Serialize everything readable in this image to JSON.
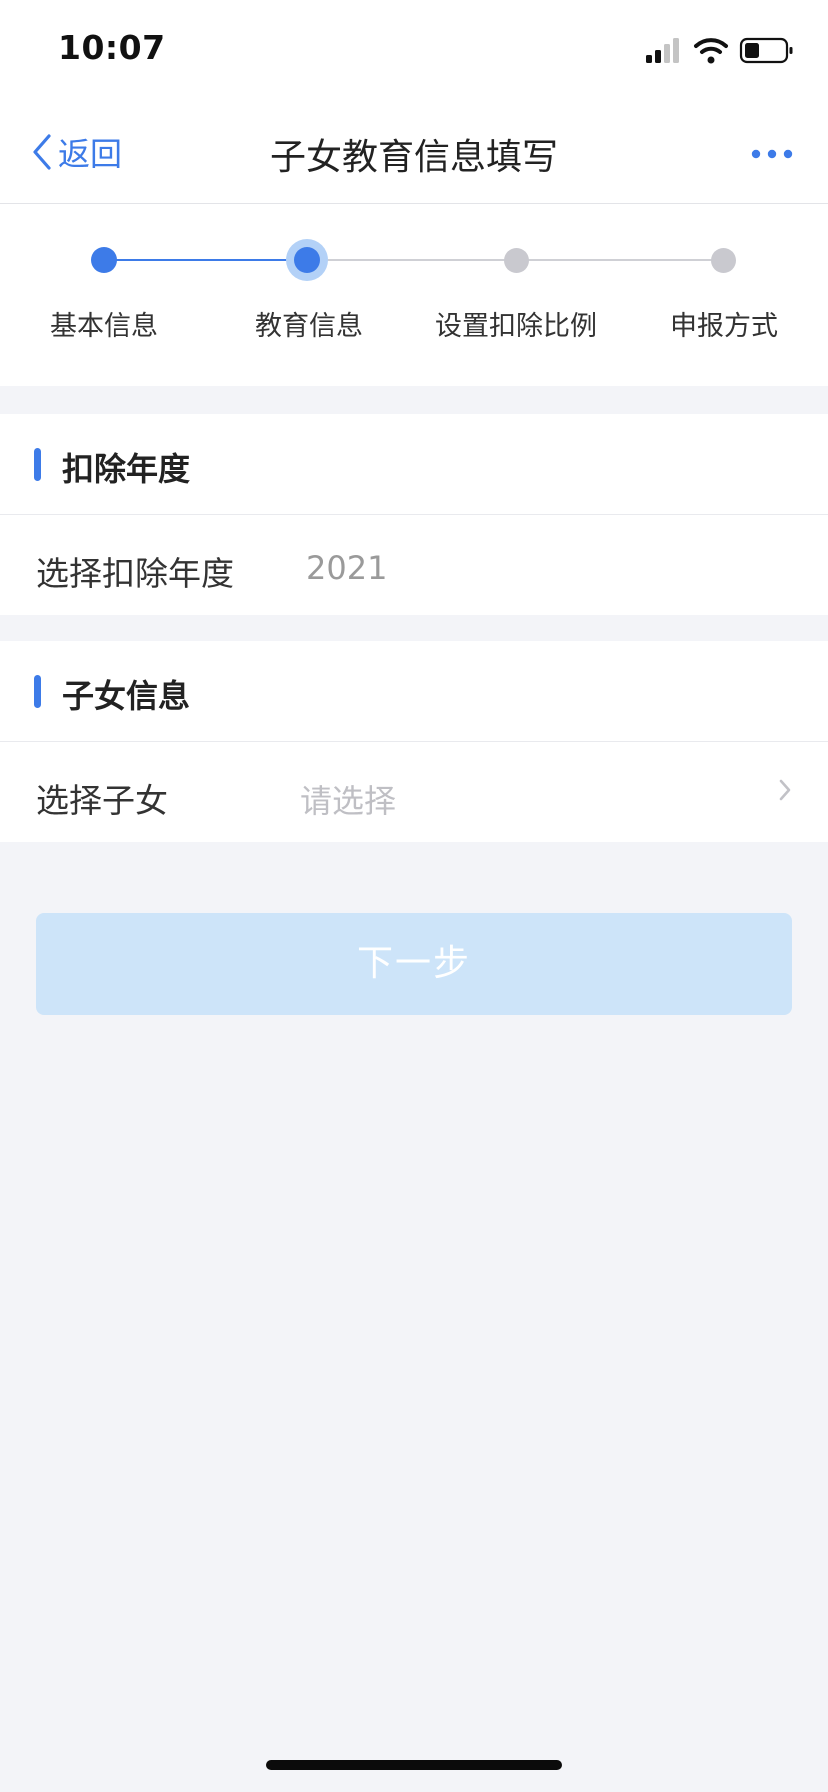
{
  "status": {
    "time": "10:07"
  },
  "nav": {
    "back_label": "返回",
    "title": "子女教育信息填写"
  },
  "steps": [
    {
      "label": "基本信息",
      "state": "done"
    },
    {
      "label": "教育信息",
      "state": "active"
    },
    {
      "label": "设置扣除比例",
      "state": "pending"
    },
    {
      "label": "申报方式",
      "state": "pending"
    }
  ],
  "deduction_year_section": {
    "title": "扣除年度",
    "row_label": "选择扣除年度",
    "row_value": "2021"
  },
  "children_section": {
    "title": "子女信息",
    "row_label": "选择子女",
    "row_placeholder": "请选择"
  },
  "next_button": {
    "label": "下一步"
  },
  "colors": {
    "accent": "#3d7be8",
    "active_ring": "#b3d1f7",
    "pending_dot": "#c9c9cf",
    "button_disabled": "#cde4f9",
    "background": "#f3f4f8"
  }
}
